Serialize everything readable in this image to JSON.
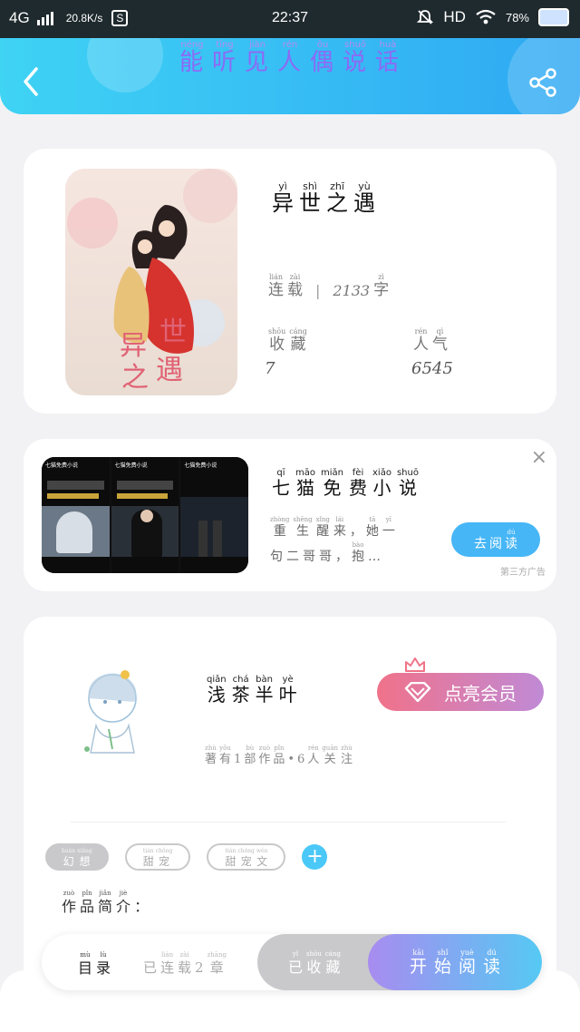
{
  "status_bar": {
    "network": "4G",
    "speed": "20.8K/s",
    "s_icon_label": "S",
    "time": "22:37",
    "hd": "HD",
    "battery_pct": "78%"
  },
  "header": {
    "title": [
      {
        "py": "néng",
        "hz": "能"
      },
      {
        "py": "tīng",
        "hz": "听"
      },
      {
        "py": "jiàn",
        "hz": "见"
      },
      {
        "py": "rén",
        "hz": "人"
      },
      {
        "py": "ǒu",
        "hz": "偶"
      },
      {
        "py": "shuō",
        "hz": "说"
      },
      {
        "py": "huà",
        "hz": "话"
      }
    ],
    "colors": {
      "gradient_start": "#3fd3f4",
      "gradient_end": "#2fa8f3",
      "title": "#8c6af5"
    }
  },
  "book": {
    "title": [
      {
        "py": "yì",
        "hz": "异"
      },
      {
        "py": "shì",
        "hz": "世"
      },
      {
        "py": "zhī",
        "hz": "之"
      },
      {
        "py": "yù",
        "hz": "遇"
      }
    ],
    "cover_text": [
      "异",
      "世",
      "之",
      "遇"
    ],
    "status": [
      {
        "py": "lián",
        "hz": "连"
      },
      {
        "py": "zài",
        "hz": "载"
      }
    ],
    "separator": "|",
    "word_count": "2133",
    "word_unit": {
      "py": "zì",
      "hz": "字"
    },
    "collect_label": [
      {
        "py": "shōu",
        "hz": "收"
      },
      {
        "py": "cáng",
        "hz": "藏"
      }
    ],
    "collect_count": "7",
    "popularity_label": [
      {
        "py": "rén",
        "hz": "人"
      },
      {
        "py": "qì",
        "hz": "气"
      }
    ],
    "popularity_count": "6545"
  },
  "ad": {
    "panel_label": "七猫免费小说",
    "title": [
      {
        "py": "qī",
        "hz": "七"
      },
      {
        "py": "māo",
        "hz": "猫"
      },
      {
        "py": "miǎn",
        "hz": "免"
      },
      {
        "py": "fèi",
        "hz": "费"
      },
      {
        "py": "xiǎo",
        "hz": "小"
      },
      {
        "py": "shuō",
        "hz": "说"
      }
    ],
    "desc_line1": [
      {
        "py": "zhòng",
        "hz": "重"
      },
      {
        "py": "shēng",
        "hz": "生"
      },
      {
        "py": "xǐng",
        "hz": "醒"
      },
      {
        "py": "lái",
        "hz": "来"
      },
      {
        "py": "",
        "hz": "，"
      },
      {
        "py": "tā",
        "hz": "她"
      },
      {
        "py": "yī",
        "hz": "一"
      }
    ],
    "desc_line2": [
      {
        "py": "",
        "hz": "句"
      },
      {
        "py": "",
        "hz": "二"
      },
      {
        "py": "",
        "hz": "哥"
      },
      {
        "py": "",
        "hz": "哥"
      },
      {
        "py": "",
        "hz": "，"
      },
      {
        "py": "bào",
        "hz": "抱"
      },
      {
        "py": "",
        "hz": "…"
      }
    ],
    "button": [
      {
        "py": "",
        "hz": "去"
      },
      {
        "py": "",
        "hz": "阅"
      },
      {
        "py": "dú",
        "hz": "读"
      }
    ],
    "source": "第三方广告",
    "close_icon": "×"
  },
  "author": {
    "name": [
      {
        "py": "qiǎn",
        "hz": "浅"
      },
      {
        "py": "chá",
        "hz": "茶"
      },
      {
        "py": "bàn",
        "hz": "半"
      },
      {
        "py": "yè",
        "hz": "叶"
      }
    ],
    "stats": [
      {
        "py": "zhù",
        "hz": "著"
      },
      {
        "py": "yǒu",
        "hz": "有"
      },
      {
        "py": "",
        "hz": "1"
      },
      {
        "py": "bù",
        "hz": "部"
      },
      {
        "py": "zuò",
        "hz": "作"
      },
      {
        "py": "pǐn",
        "hz": "品"
      },
      {
        "py": "",
        "hz": "•"
      },
      {
        "py": "",
        "hz": "6"
      },
      {
        "py": "rén",
        "hz": "人"
      },
      {
        "py": "guān",
        "hz": "关"
      },
      {
        "py": "zhù",
        "hz": "注"
      }
    ],
    "vip_label": "点亮会员"
  },
  "tags": [
    {
      "style": "filled",
      "chars": [
        {
          "py": "huàn",
          "hz": "幻"
        },
        {
          "py": "xiǎng",
          "hz": "想"
        }
      ]
    },
    {
      "style": "outline",
      "chars": [
        {
          "py": "tián",
          "hz": "甜"
        },
        {
          "py": "chǒng",
          "hz": "宠"
        }
      ]
    },
    {
      "style": "outline",
      "chars": [
        {
          "py": "tián",
          "hz": "甜"
        },
        {
          "py": "chǒng",
          "hz": "宠"
        },
        {
          "py": "wén",
          "hz": "文"
        }
      ]
    }
  ],
  "add_tag": "+",
  "intro_label": [
    {
      "py": "zuò",
      "hz": "作"
    },
    {
      "py": "pǐn",
      "hz": "品"
    },
    {
      "py": "jiǎn",
      "hz": "简"
    },
    {
      "py": "jiè",
      "hz": "介"
    },
    {
      "py": "",
      "hz": "："
    }
  ],
  "bottom_bar": {
    "toc": [
      {
        "py": "mù",
        "hz": "目"
      },
      {
        "py": "lù",
        "hz": "录"
      }
    ],
    "serial": [
      {
        "py": "",
        "hz": "已"
      },
      {
        "py": "lián",
        "hz": "连"
      },
      {
        "py": "zài",
        "hz": "载"
      },
      {
        "py": "",
        "hz": "2"
      },
      {
        "py": "zhāng",
        "hz": "章"
      }
    ],
    "collected": [
      {
        "py": "yǐ",
        "hz": "已"
      },
      {
        "py": "shōu",
        "hz": "收"
      },
      {
        "py": "cáng",
        "hz": "藏"
      }
    ],
    "start_read": [
      {
        "py": "kāi",
        "hz": "开"
      },
      {
        "py": "shǐ",
        "hz": "始"
      },
      {
        "py": "yuè",
        "hz": "阅"
      },
      {
        "py": "dú",
        "hz": "读"
      }
    ]
  }
}
